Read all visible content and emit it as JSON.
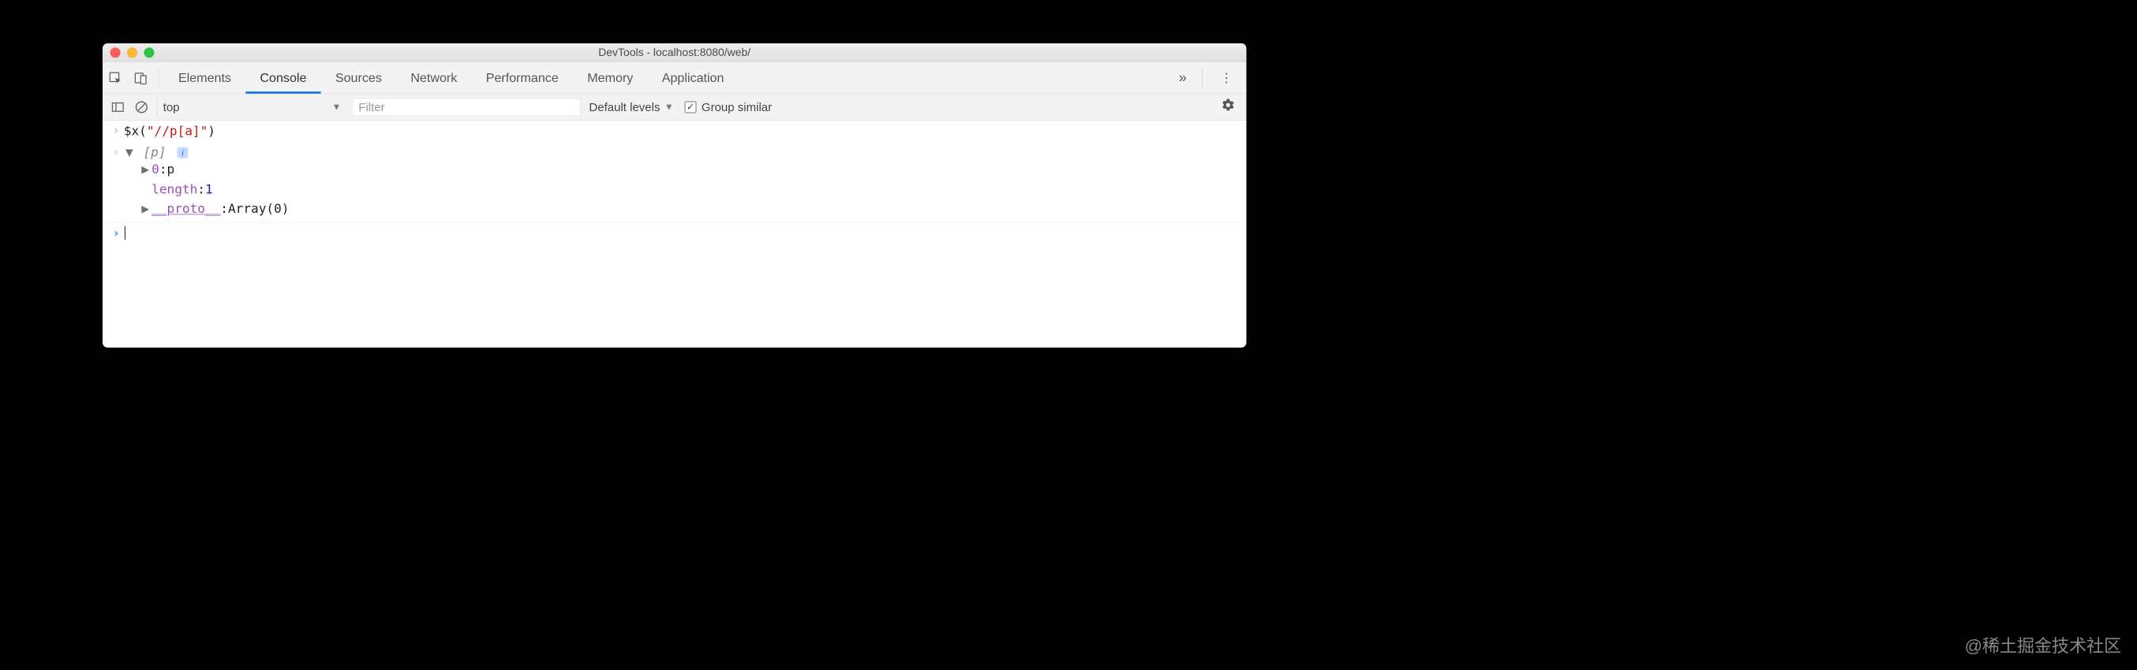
{
  "window": {
    "title": "DevTools - localhost:8080/web/"
  },
  "tabs": {
    "items": [
      "Elements",
      "Console",
      "Sources",
      "Network",
      "Performance",
      "Memory",
      "Application"
    ],
    "active": "Console"
  },
  "toolbar": {
    "context": "top",
    "filter_placeholder": "Filter",
    "levels_label": "Default levels",
    "group_label": "Group similar",
    "group_checked": true
  },
  "console": {
    "input_fn": "$x",
    "input_arg": "\"//p[a]\"",
    "result_preview": "[p]",
    "tree": [
      {
        "key": "0",
        "val": "p",
        "expandable": true,
        "key_style": "purple",
        "val_style": "dark"
      },
      {
        "key": "length",
        "val": "1",
        "expandable": false,
        "key_style": "purple",
        "val_style": "blue"
      },
      {
        "key": "__proto__",
        "val": "Array(0)",
        "expandable": true,
        "key_style": "purple-u",
        "val_style": "dark"
      }
    ]
  },
  "watermark": "@稀土掘金技术社区"
}
